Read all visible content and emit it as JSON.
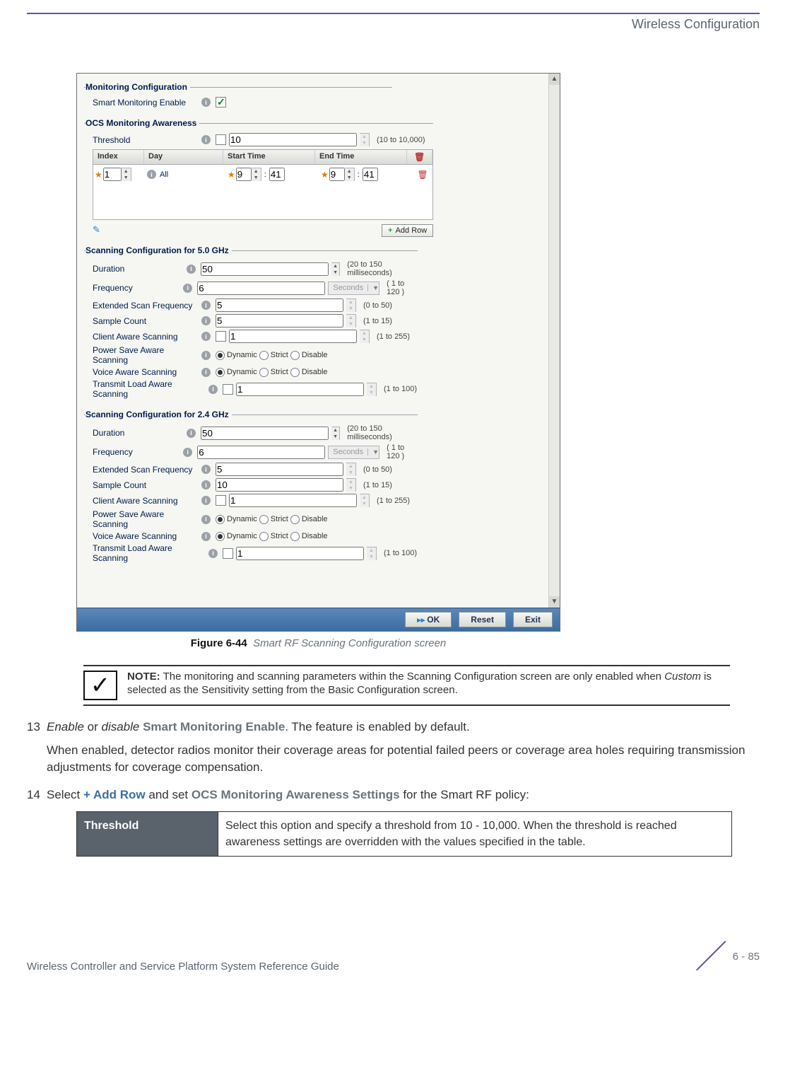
{
  "header": {
    "title": "Wireless Configuration"
  },
  "caption": {
    "fig": "Figure 6-44",
    "desc": "Smart RF Scanning Configuration screen"
  },
  "note": {
    "label": "NOTE:",
    "text_pre": "The monitoring and scanning parameters within the Scanning Configuration screen are only enabled when ",
    "text_em": "Custom",
    "text_post": " is selected as the Sensitivity setting from the Basic Configuration screen."
  },
  "steps": {
    "s13": {
      "num": "13",
      "l1_pre": "Enable",
      "l1_mid": " or ",
      "l1_pre2": "disable",
      "l1_bold": " Smart Monitoring Enable",
      "l1_post": ". The feature is enabled by default.",
      "l2": "When enabled, detector radios monitor their coverage areas for potential failed peers or coverage area holes requiring transmission adjustments for coverage compensation."
    },
    "s14": {
      "num": "14",
      "l1_a": "Select ",
      "l1_blue": "+ Add Row",
      "l1_b": " and set ",
      "l1_bold2": "OCS Monitoring Awareness Settings",
      "l1_c": " for the Smart RF policy:"
    }
  },
  "table": {
    "th": "Threshold",
    "td": "Select this option and specify a threshold from 10 - 10,000. When the threshold is reached awareness settings are overridden with the values specified in the table."
  },
  "footer": {
    "left": "Wireless Controller and Service Platform System Reference Guide",
    "right": "6 - 85"
  },
  "ui": {
    "monitoring": {
      "legend": "Monitoring Configuration",
      "smart_label": "Smart Monitoring Enable"
    },
    "ocs": {
      "legend": "OCS Monitoring Awareness",
      "threshold_label": "Threshold",
      "threshold_val": "10",
      "threshold_hint": "(10 to 10,000)",
      "cols": {
        "idx": "Index",
        "day": "Day",
        "st": "Start Time",
        "et": "End Time"
      },
      "row": {
        "idx": "1",
        "day": "All",
        "sh": "9",
        "sm": "41",
        "eh": "9",
        "em": "41"
      },
      "addrow": "Add Row"
    },
    "scan5": {
      "legend": "Scanning Configuration for 5.0 GHz",
      "duration": "Duration",
      "duration_v": "50",
      "duration_h": "(20 to 150 milliseconds)",
      "freq": "Frequency",
      "freq_v": "6",
      "freq_unit": "Seconds",
      "freq_h": "( 1 to 120 )",
      "ext": "Extended Scan Frequency",
      "ext_v": "5",
      "ext_h": "(0 to 50)",
      "samp": "Sample Count",
      "samp_v": "5",
      "samp_h": "(1 to 15)",
      "client": "Client Aware Scanning",
      "client_v": "1",
      "client_h": "(1 to 255)",
      "ps": "Power Save Aware Scanning",
      "voice": "Voice Aware Scanning",
      "tx": "Transmit Load Aware Scanning",
      "tx_v": "1",
      "tx_h": "(1 to 100)",
      "r1": "Dynamic",
      "r2": "Strict",
      "r3": "Disable"
    },
    "scan24": {
      "legend": "Scanning Configuration for 2.4 GHz",
      "duration": "Duration",
      "duration_v": "50",
      "duration_h": "(20 to 150 milliseconds)",
      "freq": "Frequency",
      "freq_v": "6",
      "freq_unit": "Seconds",
      "freq_h": "( 1 to 120 )",
      "ext": "Extended Scan Frequency",
      "ext_v": "5",
      "ext_h": "(0 to 50)",
      "samp": "Sample Count",
      "samp_v": "10",
      "samp_h": "(1 to 15)",
      "client": "Client Aware Scanning",
      "client_v": "1",
      "client_h": "(1 to 255)",
      "ps": "Power Save Aware Scanning",
      "voice": "Voice Aware Scanning",
      "tx": "Transmit Load Aware Scanning",
      "tx_v": "1",
      "tx_h": "(1 to 100)",
      "r1": "Dynamic",
      "r2": "Strict",
      "r3": "Disable"
    },
    "buttons": {
      "ok": "OK",
      "reset": "Reset",
      "exit": "Exit"
    }
  }
}
